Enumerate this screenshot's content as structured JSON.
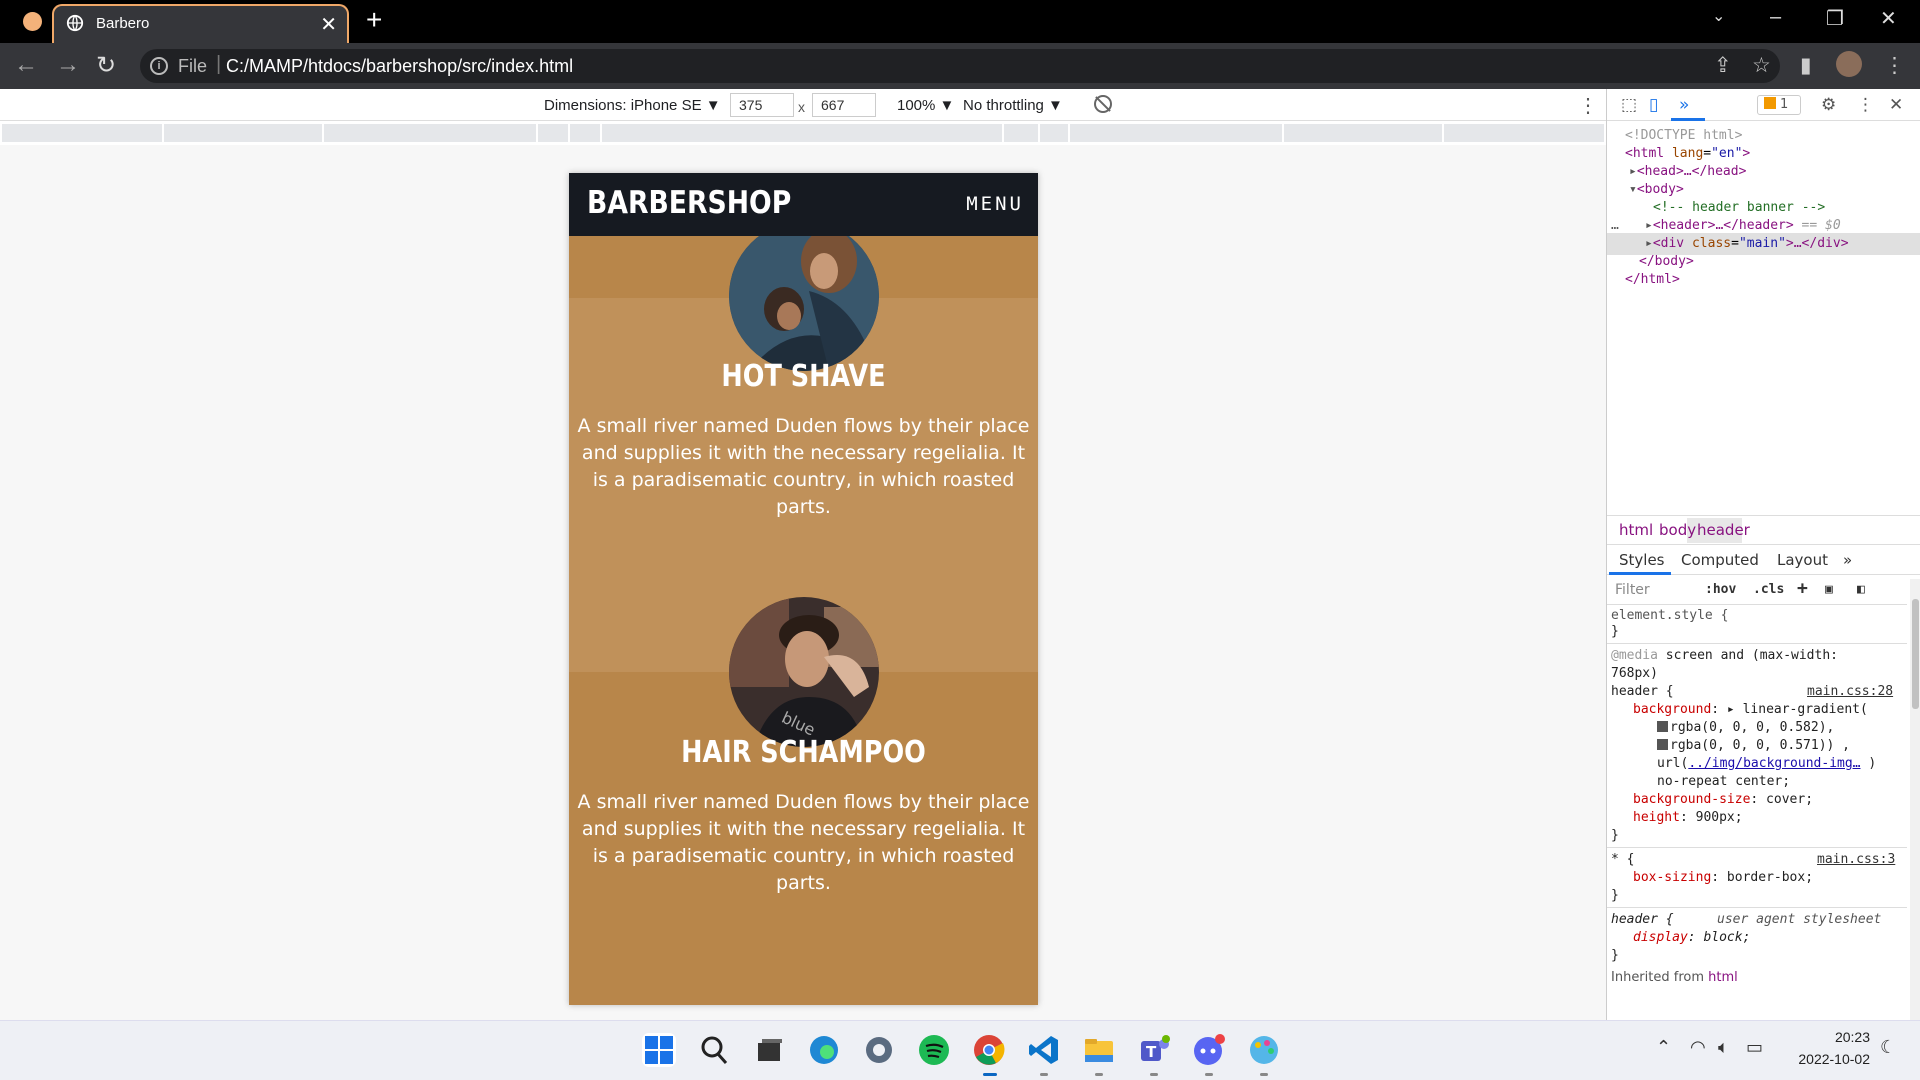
{
  "browser": {
    "tab_title": "Barbero",
    "close_symbol": "✕",
    "new_tab_symbol": "+",
    "file_label": "File",
    "url": "C:/MAMP/htdocs/barbershop/src/index.html"
  },
  "device_toolbar": {
    "dimensions_label": "Dimensions: iPhone SE ▼",
    "width": "375",
    "height": "667",
    "times": "x",
    "zoom": "100% ▼",
    "throttling": "No throttling ▼",
    "more": "⋮"
  },
  "site": {
    "brand": "BARBERSHOP",
    "menu": "MENU",
    "services": [
      {
        "title": "HOT SHAVE",
        "text": "A small river named Duden flows by their place and supplies it with the necessary regelialia. It is a paradisematic country, in which roasted parts."
      },
      {
        "title": "HAIR SCHAMPOO",
        "text": "A small river named Duden flows by their place and supplies it with the necessary regelialia. It is a paradisematic country, in which roasted parts."
      }
    ]
  },
  "devtools": {
    "badge_count": "1",
    "tree": {
      "doctype": "<!DOCTYPE html>",
      "html_open_tag": "<html",
      "html_lang_attr": " lang",
      "html_lang_val": "\"en\"",
      "html_close_bracket": ">",
      "head": "<head>…</head>",
      "body_open": "<body>",
      "comment": "<!-- header banner -->",
      "header": "<header>…</header>",
      "header_suffix": " == $0",
      "div_open": "<div",
      "div_class_attr": " class",
      "div_class_val": "\"main\"",
      "div_rest": ">…</div>",
      "body_close": "</body>",
      "html_close": "</html>",
      "ellipsis": "…"
    },
    "breadcrumbs": [
      "html",
      "body",
      "header"
    ],
    "style_tabs": [
      "Styles",
      "Computed",
      "Layout",
      "»"
    ],
    "filter_placeholder": "Filter",
    "hov": ":hov",
    "cls": ".cls",
    "styles": {
      "element_style": "element.style {",
      "close_brace": "}",
      "media": "@media",
      "media_rest": " screen and (max-width:",
      "media_rest2": "768px)",
      "header_sel": "header {",
      "src_28": "main.css:28",
      "bg_prop": "background",
      "bg_val": ": ▸ linear-gradient(",
      "rgba1": "rgba(0, 0, 0, 0.582),",
      "rgba2": "rgba(0, 0, 0, 0.571)) ,",
      "url_prefix": "url(",
      "url_link": "../img/background-img…",
      "url_suffix": " )",
      "no_repeat": "no-repeat center;",
      "bgsize_prop": "background-size",
      "bgsize_val": ": cover;",
      "height_prop": "height",
      "height_val": ": 900px;",
      "star_sel": "* {",
      "src_3": "main.css:3",
      "boxsizing_prop": "box-sizing",
      "boxsizing_val": ": border-box;",
      "header_sel2": "header {",
      "ua": "user agent stylesheet",
      "display_prop": "display",
      "display_val": ": block;",
      "inherited": "Inherited from",
      "inherited_tag": "html"
    }
  },
  "tray": {
    "time": "20:23",
    "date": "2022-10-02"
  },
  "colors": {
    "accent": "#f0a868",
    "site_header": "#161a21",
    "site_bg": "#bb8a4f"
  }
}
